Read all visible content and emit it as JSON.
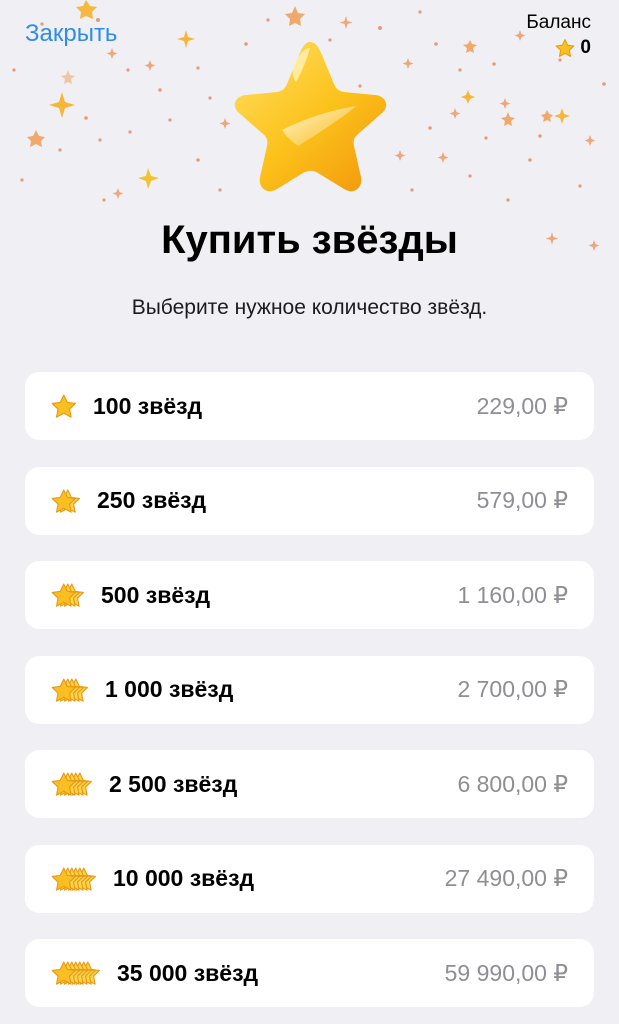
{
  "header": {
    "close_label": "Закрыть",
    "balance_label": "Баланс",
    "balance_value": "0",
    "balance_icon": "star-icon"
  },
  "hero": {
    "icon": "telegram-star-icon",
    "title": "Купить звёзды",
    "subtitle": "Выберите нужное количество звёзд."
  },
  "packages": [
    {
      "label": "100 звёзд",
      "price": "229,00 ₽",
      "stars": 1
    },
    {
      "label": "250 звёзд",
      "price": "579,00 ₽",
      "stars": 2
    },
    {
      "label": "500 звёзд",
      "price": "1 160,00 ₽",
      "stars": 3
    },
    {
      "label": "1 000 звёзд",
      "price": "2 700,00 ₽",
      "stars": 4
    },
    {
      "label": "2 500 звёзд",
      "price": "6 800,00 ₽",
      "stars": 5
    },
    {
      "label": "10 000 звёзд",
      "price": "27 490,00 ₽",
      "stars": 6
    },
    {
      "label": "35 000 звёзд",
      "price": "59 990,00 ₽",
      "stars": 7
    }
  ],
  "colors": {
    "accent": "#2f8ce8",
    "background": "#efeff4",
    "card": "#ffffff",
    "price": "#8e8e93",
    "star_gold": "#fbbf24"
  }
}
